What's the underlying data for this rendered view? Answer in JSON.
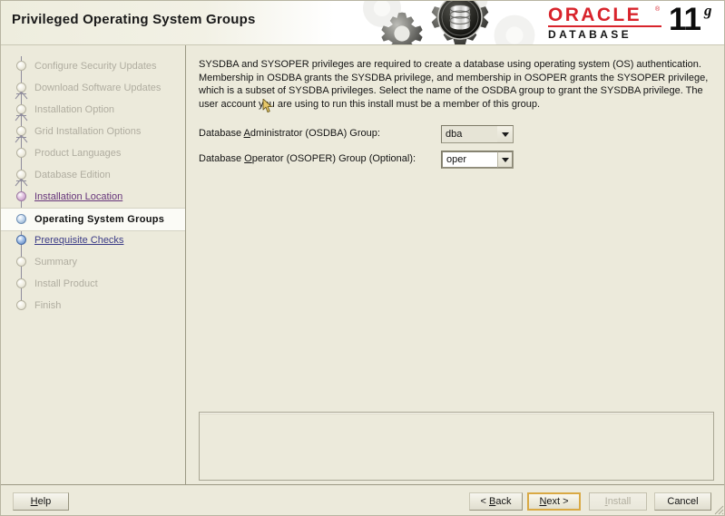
{
  "window": {
    "title": "Privileged Operating System Groups"
  },
  "brand": {
    "oracle_word": "ORACLE",
    "trademark": "®",
    "database_word": "DATABASE",
    "version_number": "11",
    "version_suffix": "g",
    "art_icon": "gears-database-icon",
    "red": "#d8242c",
    "black": "#0d0d0d"
  },
  "sidebar": {
    "items": [
      {
        "label": "Configure Security Updates",
        "state": "pending",
        "branch": false
      },
      {
        "label": "Download Software Updates",
        "state": "pending",
        "branch": true
      },
      {
        "label": "Installation Option",
        "state": "pending",
        "branch": true
      },
      {
        "label": "Grid Installation Options",
        "state": "pending",
        "branch": true
      },
      {
        "label": "Product Languages",
        "state": "pending",
        "branch": false
      },
      {
        "label": "Database Edition",
        "state": "pending",
        "branch": true
      },
      {
        "label": "Installation Location",
        "state": "visited",
        "branch": false
      },
      {
        "label": "Operating System Groups",
        "state": "current",
        "branch": false
      },
      {
        "label": "Prerequisite Checks",
        "state": "next",
        "branch": false
      },
      {
        "label": "Summary",
        "state": "pending",
        "branch": false
      },
      {
        "label": "Install Product",
        "state": "pending",
        "branch": false
      },
      {
        "label": "Finish",
        "state": "pending",
        "branch": false
      }
    ]
  },
  "main": {
    "description": "SYSDBA and SYSOPER privileges are required to create a database using operating system (OS) authentication. Membership in OSDBA grants the SYSDBA privilege, and membership in OSOPER grants the SYSOPER privilege, which is a subset of SYSDBA privileges. Select the name of the OSDBA group to grant the SYSDBA privilege. The user account you are using to run this install must be a member of this group.",
    "fields": [
      {
        "label_before": "Database ",
        "label_mnemonic": "A",
        "label_after": "dministrator (OSDBA) Group:",
        "value": "dba",
        "editable": false
      },
      {
        "label_before": "Database ",
        "label_mnemonic": "O",
        "label_after": "perator (OSOPER) Group (Optional):",
        "value": "oper",
        "editable": true
      }
    ],
    "message_panel_text": ""
  },
  "footer": {
    "help": {
      "before": "",
      "mnemonic": "H",
      "after": "elp"
    },
    "back": {
      "before": "< ",
      "mnemonic": "B",
      "after": "ack"
    },
    "next": {
      "before": "",
      "mnemonic": "N",
      "after": "ext >"
    },
    "install": {
      "before": "",
      "mnemonic": "I",
      "after": "nstall"
    },
    "cancel": {
      "before": "",
      "mnemonic": "",
      "after": "Cancel"
    }
  }
}
